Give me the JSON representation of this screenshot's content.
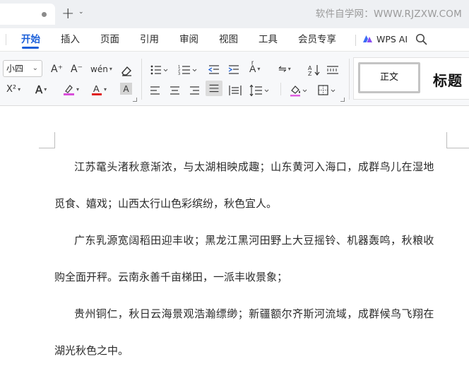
{
  "titlebar": {
    "new_tab_icon": "plus-icon",
    "watermark": "软件自学网：WWW.RJZXW.COM"
  },
  "menu": {
    "tabs": [
      "开始",
      "插入",
      "页面",
      "引用",
      "审阅",
      "视图",
      "工具",
      "会员专享"
    ],
    "active_tab": "开始",
    "ai_label": "WPS AI"
  },
  "ribbon": {
    "font_size": "小四",
    "increase_font_glyph": "A⁺",
    "decrease_font_glyph": "A⁻",
    "phonetic_glyph": "wén",
    "superscript_glyph": "X²",
    "styles": {
      "normal": "正文",
      "heading": "标题"
    }
  },
  "document": {
    "paragraphs": [
      {
        "first_line": "江苏鼋头渚秋意渐浓，与太湖相映成趣；山东黄河入海口，成群鸟儿在湿地",
        "rest": "觅食、嬉戏；山西太行山色彩缤纷，秋色宜人。"
      },
      {
        "first_line": "广东乳源宽阔稻田迎丰收；黑龙江黑河田野上大豆摇铃、机器轰鸣，秋粮收",
        "rest": "购全面开秤。云南永善千亩梯田，一派丰收景象；"
      },
      {
        "first_line": "贵州铜仁，秋日云海景观浩瀚缥缈；新疆额尔齐斯河流域，成群候鸟飞翔在",
        "rest": "湖光秋色之中。"
      }
    ]
  },
  "colors": {
    "accent": "#1a5fd9",
    "titlebar_bg": "#eef0f3",
    "ribbon_bg": "#f7f8fa"
  }
}
